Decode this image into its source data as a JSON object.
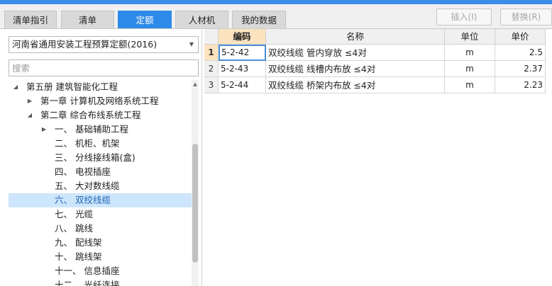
{
  "tabs": [
    {
      "label": "清单指引",
      "active": false
    },
    {
      "label": "清单",
      "active": false
    },
    {
      "label": "定额",
      "active": true
    },
    {
      "label": "人材机",
      "active": false
    },
    {
      "label": "我的数据",
      "active": false
    }
  ],
  "toolbar": {
    "insert_label": "插入(I)",
    "replace_label": "替换(R)"
  },
  "left_panel": {
    "library_select": "河南省通用安装工程预算定额(2016)",
    "search_placeholder": "搜索",
    "tree": [
      {
        "label": "第五册 建筑智能化工程",
        "expanded": true,
        "selected": false
      },
      {
        "label": "第一章 计算机及网络系统工程",
        "expanded": false,
        "selected": false
      },
      {
        "label": "第二章 综合布线系统工程",
        "expanded": true,
        "selected": false
      },
      {
        "label": "一、 基础辅助工程",
        "expanded": false,
        "selected": false
      },
      {
        "label": "二、 机柜、机架",
        "selected": false
      },
      {
        "label": "三、 分线接线箱(盒)",
        "selected": false
      },
      {
        "label": "四、 电视插座",
        "selected": false
      },
      {
        "label": "五、 大对数线缆",
        "selected": false
      },
      {
        "label": "六、 双绞线缆",
        "selected": true
      },
      {
        "label": "七、 光缆",
        "selected": false
      },
      {
        "label": "八、 跳线",
        "selected": false
      },
      {
        "label": "九、 配线架",
        "selected": false
      },
      {
        "label": "十、 跳线架",
        "selected": false
      },
      {
        "label": "十一、 信息插座",
        "selected": false
      },
      {
        "label": "十二、 光纤连接",
        "selected": false
      }
    ]
  },
  "grid": {
    "columns": [
      "编码",
      "名称",
      "单位",
      "单价"
    ],
    "rows": [
      {
        "num": "1",
        "code": "5-2-42",
        "name": "双绞线缆 管内穿放 ≤4对",
        "unit": "m",
        "price": "2.5"
      },
      {
        "num": "2",
        "code": "5-2-43",
        "name": "双绞线缆 线槽内布放 ≤4对",
        "unit": "m",
        "price": "2.37"
      },
      {
        "num": "3",
        "code": "5-2-44",
        "name": "双绞线缆 桥架内布放 ≤4对",
        "unit": "m",
        "price": "2.23"
      }
    ]
  },
  "colors": {
    "accent": "#2d8ae8",
    "selected_row": "#cde6fb",
    "header_highlight": "#fbe3c0"
  }
}
